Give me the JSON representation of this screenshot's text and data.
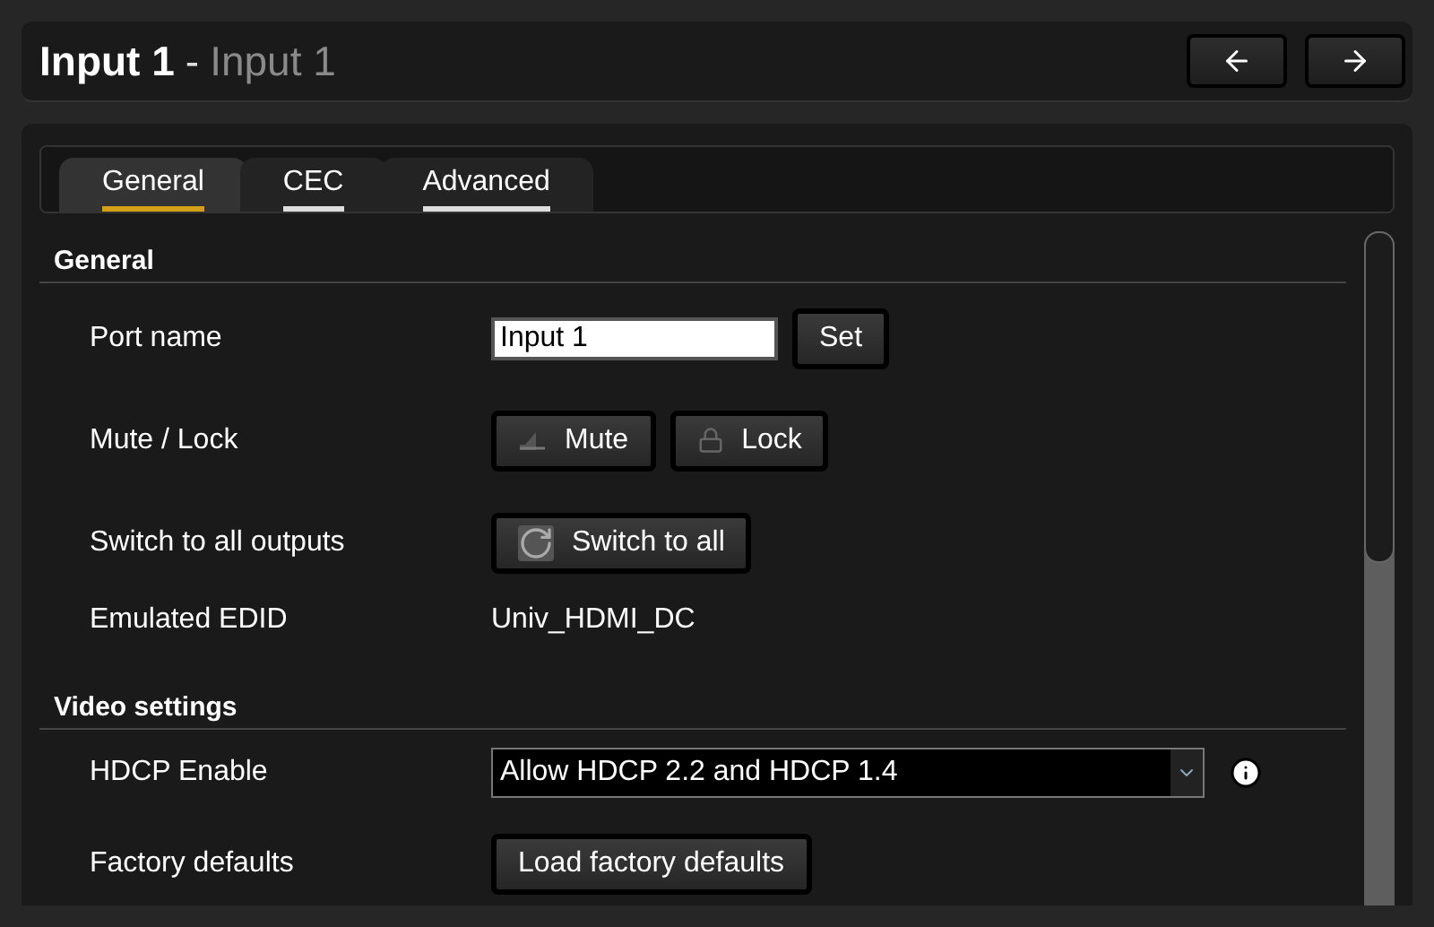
{
  "header": {
    "title": "Input 1",
    "separator": "-",
    "subtitle": "Input 1"
  },
  "tabs": [
    {
      "label": "General",
      "selected": true
    },
    {
      "label": "CEC",
      "selected": false
    },
    {
      "label": "Advanced",
      "selected": false
    }
  ],
  "sections": [
    {
      "title": "General",
      "rows": [
        {
          "kind": "text_input",
          "label": "Port name",
          "value": "Input 1",
          "button": "Set"
        },
        {
          "kind": "buttons",
          "label": "Mute / Lock",
          "buttons": [
            {
              "label": "Mute",
              "kind": "mute"
            },
            {
              "label": "Lock",
              "kind": "lock"
            }
          ]
        },
        {
          "kind": "buttons",
          "label": "Switch to all outputs",
          "buttons": [
            {
              "label": "Switch to all",
              "kind": "switch"
            }
          ]
        },
        {
          "kind": "value",
          "label": "Emulated EDID",
          "value": "Univ_HDMI_DC"
        }
      ]
    },
    {
      "title": "Video settings",
      "rows": [
        {
          "kind": "select",
          "label": "HDCP Enable",
          "value": "Allow HDCP 2.2 and HDCP 1.4"
        },
        {
          "kind": "buttons",
          "label": "Factory defaults",
          "buttons": [
            {
              "label": "Load factory defaults"
            }
          ]
        }
      ]
    }
  ]
}
